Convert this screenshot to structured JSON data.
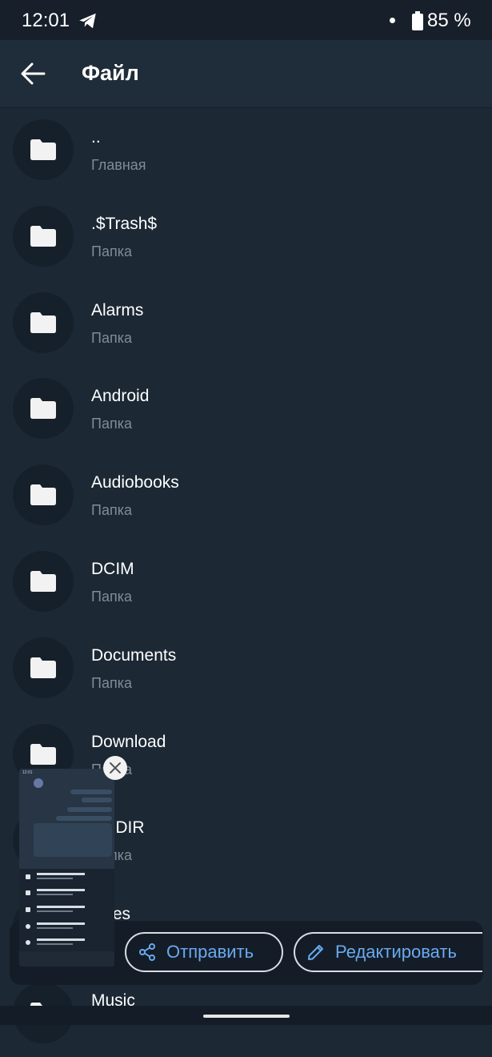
{
  "status_bar": {
    "time": "12:01",
    "battery": "85 %",
    "icons": [
      "telegram-icon",
      "notification-dot",
      "battery-icon"
    ]
  },
  "app_bar": {
    "title": "Файл",
    "back_icon": "arrow-back-icon"
  },
  "files": [
    {
      "name": "..",
      "subtitle": "Главная"
    },
    {
      "name": ".$Trash$",
      "subtitle": "Папка"
    },
    {
      "name": "Alarms",
      "subtitle": "Папка"
    },
    {
      "name": "Android",
      "subtitle": "Папка"
    },
    {
      "name": "Audiobooks",
      "subtitle": "Папка"
    },
    {
      "name": "DCIM",
      "subtitle": "Папка"
    },
    {
      "name": "Documents",
      "subtitle": "Папка"
    },
    {
      "name": "Download",
      "subtitle": "Папка"
    },
    {
      "name": "ST.DIR",
      "subtitle": "Папка"
    },
    {
      "name": "ovies",
      "subtitle": ""
    },
    {
      "name": "Music",
      "subtitle": ""
    }
  ],
  "actions": {
    "send_label": "Отправить",
    "edit_label": "Редактировать"
  },
  "colors": {
    "background": "#1c2834",
    "accent": "#6aa9f0",
    "subtitle": "#7f8d99"
  }
}
